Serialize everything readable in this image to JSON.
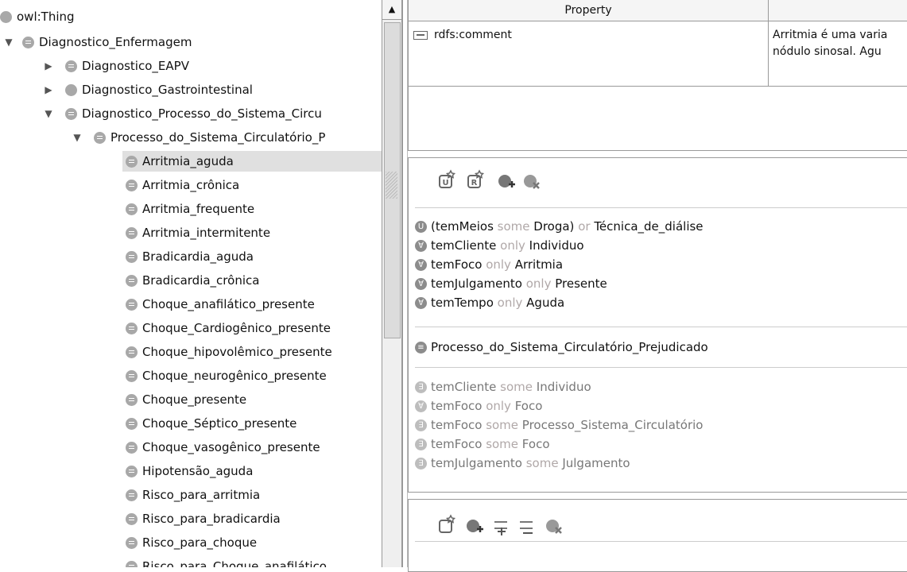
{
  "tree": {
    "root": "owl:Thing",
    "nodes": [
      {
        "label": "Diagnostico_Enfermagem",
        "toggle": "▼"
      },
      {
        "label": "Diagnostico_EAPV",
        "toggle": "▶"
      },
      {
        "label": "Diagnostico_Gastrointestinal",
        "toggle": "▶"
      },
      {
        "label": "Diagnostico_Processo_do_Sistema_Circu",
        "toggle": "▼"
      },
      {
        "label": "Processo_do_Sistema_Circulatório_P",
        "toggle": "▼"
      }
    ],
    "leaves": [
      "Arritmia_aguda",
      "Arritmia_crônica",
      "Arritmia_frequente",
      "Arritmia_intermitente",
      "Bradicardia_aguda",
      "Bradicardia_crônica",
      "Choque_anafilático_presente",
      "Choque_Cardiogênico_presente",
      "Choque_hipovolêmico_presente",
      "Choque_neurogênico_presente",
      "Choque_presente",
      "Choque_Séptico_presente",
      "Choque_vasogênico_presente",
      "Hipotensão_aguda",
      "Risco_para_arritmia",
      "Risco_para_bradicardia",
      "Risco_para_choque",
      "Risco_para_Choque_anafilático"
    ],
    "selected": "Arritmia_aguda"
  },
  "annotations": {
    "header_property": "Property",
    "header_value": "",
    "property": "rdfs:comment",
    "value_line1": "Arritmia é uma varia",
    "value_line2": "nódulo sinosal. Agu"
  },
  "toolbar1": [
    "add-equivalent-icon",
    "add-superclass-icon",
    "add-instance-icon",
    "remove-icon"
  ],
  "toolbar1_labels": {
    "a": "U",
    "b": "R"
  },
  "axioms_group1": [
    {
      "icon": "union-icon",
      "badge": "U",
      "parts": [
        [
          "(temMeios ",
          ""
        ],
        [
          "some",
          "kw"
        ],
        [
          " Droga) ",
          ""
        ],
        [
          "or",
          "kw"
        ],
        [
          " Técnica_de_diálise",
          ""
        ]
      ]
    },
    {
      "icon": "restriction-icon",
      "badge": "∀",
      "parts": [
        [
          "temCliente ",
          ""
        ],
        [
          "only",
          "kw"
        ],
        [
          " Individuo",
          ""
        ]
      ]
    },
    {
      "icon": "restriction-icon",
      "badge": "∀",
      "parts": [
        [
          "temFoco ",
          ""
        ],
        [
          "only",
          "kw"
        ],
        [
          " Arritmia",
          ""
        ]
      ]
    },
    {
      "icon": "restriction-icon",
      "badge": "∀",
      "parts": [
        [
          "temJulgamento ",
          ""
        ],
        [
          "only",
          "kw"
        ],
        [
          " Presente",
          ""
        ]
      ]
    },
    {
      "icon": "restriction-icon",
      "badge": "∀",
      "parts": [
        [
          "temTempo ",
          ""
        ],
        [
          "only",
          "kw"
        ],
        [
          " Aguda",
          ""
        ]
      ]
    }
  ],
  "superclass": "Processo_do_Sistema_Circulatório_Prejudicado",
  "axioms_group2": [
    {
      "badge": "∃",
      "parts": [
        [
          "temCliente ",
          ""
        ],
        [
          "some",
          "kw"
        ],
        [
          " Individuo",
          ""
        ]
      ]
    },
    {
      "badge": "∀",
      "parts": [
        [
          "temFoco ",
          ""
        ],
        [
          "only",
          "kw"
        ],
        [
          " Foco",
          ""
        ]
      ]
    },
    {
      "badge": "∃",
      "parts": [
        [
          "temFoco ",
          ""
        ],
        [
          "some",
          "kw"
        ],
        [
          " Processo_Sistema_Circulatório",
          ""
        ]
      ]
    },
    {
      "badge": "∃",
      "parts": [
        [
          "temFoco ",
          ""
        ],
        [
          "some",
          "kw"
        ],
        [
          " Foco",
          ""
        ]
      ]
    },
    {
      "badge": "∃",
      "parts": [
        [
          "temJulgamento ",
          ""
        ],
        [
          "some",
          "kw"
        ],
        [
          " Julgamento",
          ""
        ]
      ]
    }
  ]
}
